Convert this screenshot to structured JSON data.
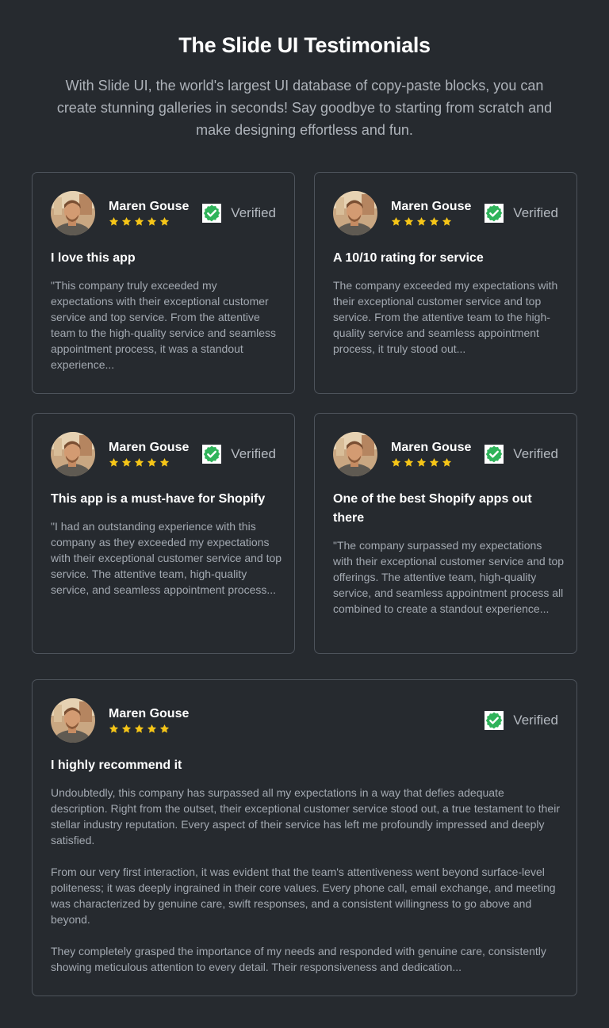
{
  "header": {
    "title": "The Slide UI Testimonials",
    "subtitle": "With Slide UI, the world's largest UI database of copy-paste blocks, you can create stunning galleries in seconds! Say goodbye to starting from scratch and make designing effortless and fun."
  },
  "colors": {
    "background": "#262a2f",
    "card_border": "#4d535b",
    "star": "#f5c518",
    "verified_green": "#2fb35a"
  },
  "icons": {
    "rating": "star-icon",
    "verified": "verified-badge-icon",
    "avatar": "user-avatar"
  },
  "cards": [
    {
      "name": "Maren Gouse",
      "rating": 5,
      "verified_label": "Verified",
      "headline": "I love this app",
      "paragraphs": [
        "\"This company truly exceeded my expectations with their exceptional customer service and top service. From the attentive team to the high-quality service and seamless appointment process, it was a standout experience..."
      ]
    },
    {
      "name": "Maren Gouse",
      "rating": 5,
      "verified_label": "Verified",
      "headline": "A 10/10 rating for service",
      "paragraphs": [
        "The company exceeded my expectations with their exceptional customer service and top service. From the attentive team to the high-quality service and seamless appointment process, it truly stood out..."
      ]
    },
    {
      "name": "Maren Gouse",
      "rating": 5,
      "verified_label": "Verified",
      "headline": "This app is a must-have for Shopify",
      "paragraphs": [
        "\"I had an outstanding experience with this company as they exceeded my expectations with their exceptional customer service and top service. The attentive team, high-quality service, and seamless appointment process..."
      ]
    },
    {
      "name": "Maren Gouse",
      "rating": 5,
      "verified_label": "Verified",
      "headline": "One of the best Shopify apps out there",
      "paragraphs": [
        "\"The company surpassed my expectations with their exceptional customer service and top offerings. The attentive team, high-quality service, and seamless appointment process all combined to create a standout experience..."
      ]
    },
    {
      "name": "Maren Gouse",
      "rating": 5,
      "verified_label": "Verified",
      "headline": "I highly recommend it",
      "paragraphs": [
        "Undoubtedly, this company has surpassed all my expectations in a way that defies adequate description. Right from the outset, their exceptional customer service stood out, a true testament to their stellar industry reputation. Every aspect of their service has left me profoundly impressed and deeply satisfied.",
        "From our very first interaction, it was evident that the team's attentiveness went beyond surface-level politeness; it was deeply ingrained in their core values. Every phone call, email exchange, and meeting was characterized by genuine care, swift responses, and a consistent willingness to go above and beyond.",
        "They completely grasped the importance of my needs and responded with genuine care, consistently showing meticulous attention to every detail. Their responsiveness and dedication..."
      ]
    }
  ]
}
